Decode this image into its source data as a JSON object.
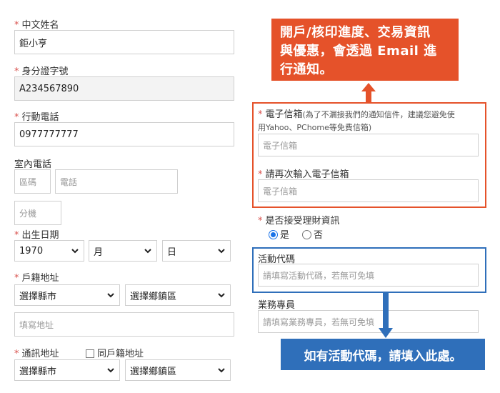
{
  "form": {
    "chinese_name": {
      "label": "中文姓名",
      "value": "鉅小亨"
    },
    "id_number": {
      "label": "身分證字號",
      "value": "A234567890"
    },
    "mobile": {
      "label": "行動電話",
      "value": "0977777777"
    },
    "home_phone": {
      "label": "室內電話",
      "area_placeholder": "區碼",
      "phone_placeholder": "電話",
      "ext_placeholder": "分機"
    },
    "birthdate": {
      "label": "出生日期",
      "year": "1970",
      "month": "月",
      "day": "日"
    },
    "registered_address": {
      "label": "戶籍地址",
      "county": "選擇縣市",
      "district": "選擇鄉鎮區",
      "address_placeholder": "填寫地址"
    },
    "mailing_address": {
      "label": "通訊地址",
      "same_as_label": "同戶籍地址",
      "county": "選擇縣市",
      "district": "選擇鄉鎮區"
    },
    "email": {
      "label": "電子信箱",
      "hint_line1": "(為了不漏接我們的通知信件，建議您避免使",
      "hint_line2": "用Yahoo、PChome等免費信箱)",
      "placeholder": "電子信箱"
    },
    "email_confirm": {
      "label": "請再次輸入電子信箱",
      "placeholder": "電子信箱"
    },
    "finance_info": {
      "label": "是否接受理財資訊",
      "yes": "是",
      "no": "否",
      "selected": "是"
    },
    "promo_code": {
      "label": "活動代碼",
      "placeholder": "請填寫活動代碼，若無可免填"
    },
    "sales_rep": {
      "label": "業務專員",
      "placeholder": "請填寫業務專員，若無可免填"
    }
  },
  "required_mark": "*",
  "callouts": {
    "email_notice": {
      "line1": "開戶/核印進度、交易資訊",
      "line2": "與優惠，會透過 Email 進",
      "line3": "行通知。",
      "color": "#e5522a"
    },
    "promo_notice": {
      "text": "如有活動代碼，請填入此處。",
      "color": "#2f6fba"
    }
  },
  "icons": {
    "select": "chevron-down-icon",
    "arrow_up": "arrow-up-icon",
    "arrow_down": "arrow-down-icon"
  }
}
